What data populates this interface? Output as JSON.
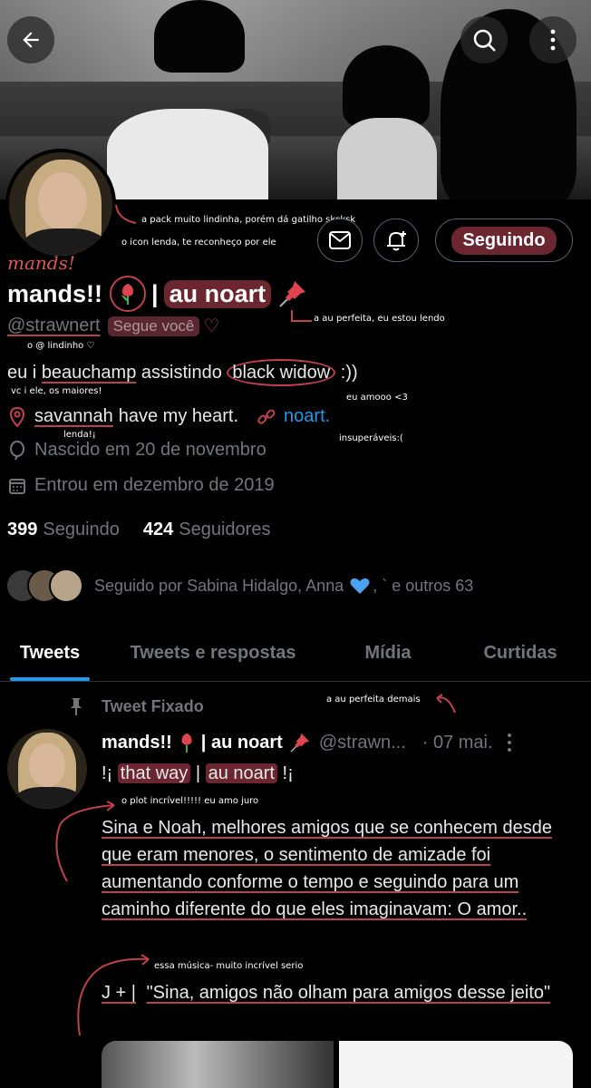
{
  "header": {
    "back_icon": "arrow-left-icon",
    "search_icon": "search-icon",
    "more_icon": "more-vertical-icon"
  },
  "annotations": {
    "pack": "a pack muito lindinha, porém dá gatilho sksksk",
    "icon": "o icon lenda, te reconheço por ele",
    "mands": "mands!",
    "au_perfeita": "a au perfeita, eu estou lendo",
    "lindinho": "o @ lindinho ♡",
    "vc_e_ele": "vc i ele, os maiores!",
    "amooo": "eu amooo <3",
    "lenda": "lenda!¡",
    "insuperaveis": "insuperáveis:(",
    "au_perfeita_demais": "a au perfeita demais",
    "plot": "o plot incrível!!!!! eu amo juro",
    "musica": "essa música- muito incrível serio"
  },
  "profile": {
    "name_prefix": "mands!!",
    "name_sep": "|",
    "name_highlight": "au noart",
    "handle": "@strawnert",
    "follows_you": "Segue você",
    "follow_button": "Seguindo",
    "bio_a": "eu i",
    "bio_b": "beauchamp",
    "bio_c": "assistindo",
    "bio_d": "black widow",
    "bio_e": ":))",
    "location_a": "savannah",
    "location_b": "have my heart.",
    "website": "noart.",
    "birthday": "Nascido em 20 de novembro",
    "joined": "Entrou em dezembro de 2019",
    "following_count": "399",
    "following_label": "Seguindo",
    "followers_count": "424",
    "followers_label": "Seguidores",
    "followed_by_a": "Seguido por Sabina Hidalgo, Anna",
    "followed_by_b": ", ` e outros 63"
  },
  "tabs": [
    {
      "label": "Tweets"
    },
    {
      "label": "Tweets e respostas"
    },
    {
      "label": "Mídia"
    },
    {
      "label": "Curtidas"
    }
  ],
  "tweet": {
    "pinned_label": "Tweet Fixado",
    "author": "mands!!",
    "author_sep": "| au noart",
    "handle": "@strawn...",
    "date": "· 07 mai.",
    "line1_a": "!¡",
    "line1_b": "that way",
    "line1_c": "|",
    "line1_d": "au noart",
    "line1_e": "!¡",
    "body": "Sina e Noah, melhores amigos que se conhecem desde que eram menores, o sentimento de amizade foi aumentando conforme o tempo e seguindo para um caminho diferente do que eles imaginavam: O amor..",
    "quote_a": "J + |",
    "quote_b": "\"Sina, amigos não olham para amigos desse jeito\""
  },
  "colors": {
    "accent": "#1d9bf0",
    "highlight": "#6b2630",
    "annotation_red": "#c0404c"
  }
}
